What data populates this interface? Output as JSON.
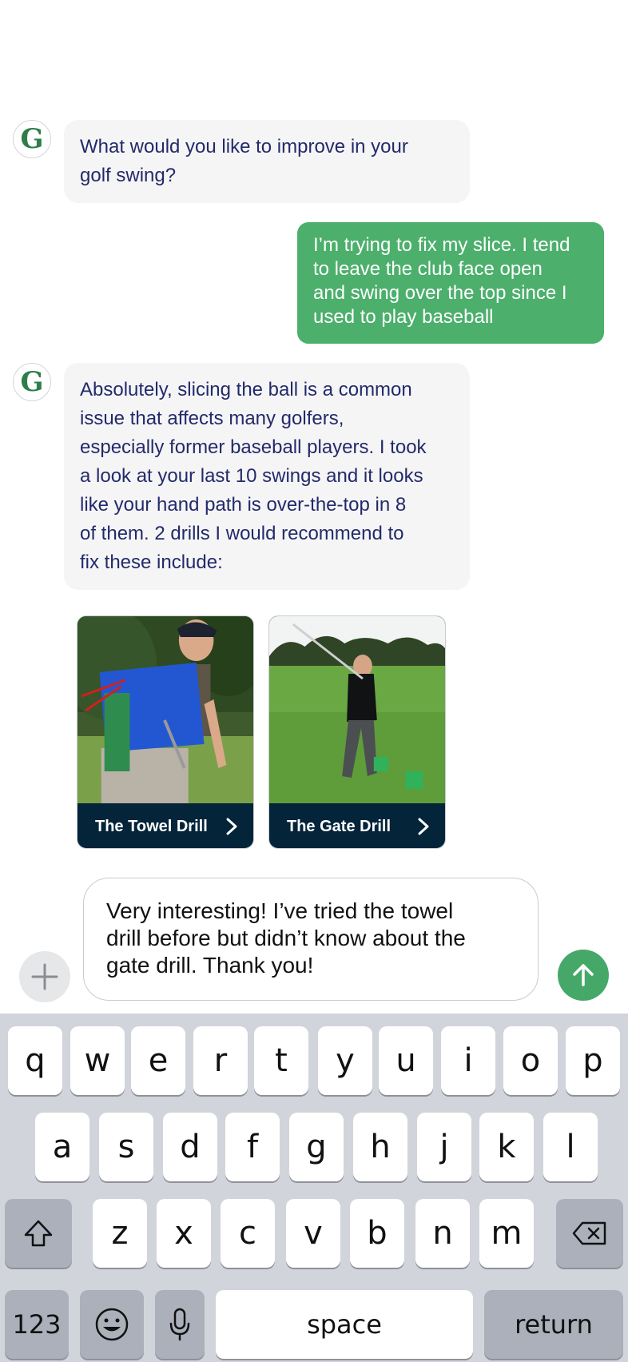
{
  "avatar_letter": "G",
  "messages": {
    "q1": {
      "line1": "What would you like to improve in your",
      "line2": "golf swing?"
    },
    "user1": {
      "line1": "I’m trying to fix my slice. I tend",
      "line2": "to leave the club face open",
      "line3": "and swing over the top since I",
      "line4": "used to play baseball"
    },
    "reply": {
      "line1": "Absolutely, slicing the ball is a common",
      "line2": "issue that affects many golfers,",
      "line3": "especially former baseball players. I took",
      "line4": "a look at your last 10 swings and it looks",
      "line5": "like your hand path is over-the-top in 8",
      "line6": "of them. 2 drills I would recommend to",
      "line7": "fix these include:"
    }
  },
  "drills": [
    {
      "label": "The Towel Drill"
    },
    {
      "label": "The Gate Drill"
    }
  ],
  "composer": {
    "line1": "Very interesting! I’ve tried the towel",
    "line2": "drill before but didn’t know about the",
    "line3": "gate drill. Thank you!"
  },
  "icons": {
    "add": "plus-icon",
    "send": "arrow-up-icon",
    "shift": "shift-icon",
    "delete": "backspace-icon",
    "emoji": "emoji-icon",
    "mic": "microphone-icon",
    "chevron": "chevron-right-icon"
  },
  "colors": {
    "accent_green": "#4caf6c",
    "incoming_text": "#232a6a",
    "card_bar": "#04243a"
  },
  "keyboard": {
    "row1": [
      "q",
      "w",
      "e",
      "r",
      "t",
      "y",
      "u",
      "i",
      "o",
      "p"
    ],
    "row2": [
      "a",
      "s",
      "d",
      "f",
      "g",
      "h",
      "j",
      "k",
      "l"
    ],
    "row3": [
      "z",
      "x",
      "c",
      "v",
      "b",
      "n",
      "m"
    ],
    "numbers": "123",
    "space": "space",
    "return": "return"
  }
}
